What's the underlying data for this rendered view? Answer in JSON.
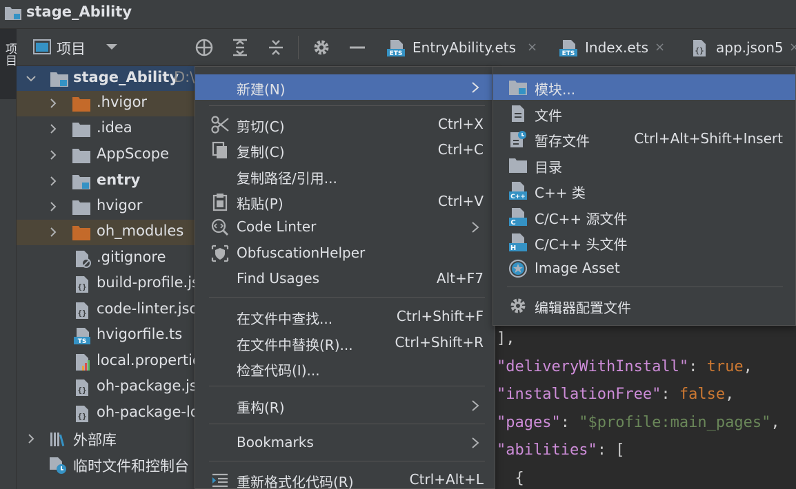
{
  "window": {
    "title": "stage_Ability"
  },
  "left_strip": {
    "tab_label": "项目"
  },
  "project_toolbar": {
    "label": "项目",
    "icons": [
      "project-window-icon",
      "dropdown-icon",
      "locate-icon",
      "expand-all-icon",
      "collapse-all-icon",
      "gear-icon",
      "hide-icon"
    ]
  },
  "editor_tabs": [
    {
      "label": "EntryAbility.ets",
      "icon": "ets-file-icon",
      "close": "×"
    },
    {
      "label": "Index.ets",
      "icon": "ets-file-icon",
      "close": "×"
    },
    {
      "label": "app.json5",
      "icon": "json-file-icon",
      "close": "×"
    }
  ],
  "tree": {
    "root": {
      "label": "stage_Ability",
      "path": "D:\\"
    },
    "items": [
      {
        "label": ".hvigor",
        "type": "folder-excluded"
      },
      {
        "label": ".idea",
        "type": "folder"
      },
      {
        "label": "AppScope",
        "type": "folder"
      },
      {
        "label": "entry",
        "type": "module"
      },
      {
        "label": "hvigor",
        "type": "folder"
      },
      {
        "label": "oh_modules",
        "type": "folder-excluded"
      },
      {
        "label": ".gitignore",
        "type": "file-ignore"
      },
      {
        "label": "build-profile.js",
        "type": "file-json"
      },
      {
        "label": "code-linter.jso",
        "type": "file-json"
      },
      {
        "label": "hvigorfile.ts",
        "type": "file-ts"
      },
      {
        "label": "local.propertie",
        "type": "file-props"
      },
      {
        "label": "oh-package.js",
        "type": "file-json"
      },
      {
        "label": "oh-package-lo",
        "type": "file-json"
      }
    ],
    "external_libraries": "外部库",
    "scratches": "临时文件和控制台"
  },
  "context_menu": {
    "items": [
      {
        "label": "新建(N)",
        "shortcut": "",
        "submenu": true,
        "highlighted": true
      },
      {
        "label": "剪切(C)",
        "shortcut": "Ctrl+X",
        "icon": "cut-icon"
      },
      {
        "label": "复制(C)",
        "shortcut": "Ctrl+C",
        "icon": "copy-icon"
      },
      {
        "label": "复制路径/引用...",
        "shortcut": ""
      },
      {
        "label": "粘贴(P)",
        "shortcut": "Ctrl+V",
        "icon": "paste-icon"
      },
      {
        "label": "Code Linter",
        "shortcut": "",
        "submenu": true,
        "icon": "code-linter-icon"
      },
      {
        "label": "ObfuscationHelper",
        "shortcut": "",
        "icon": "obfuscation-icon"
      },
      {
        "label": "Find Usages",
        "shortcut": "Alt+F7"
      },
      {
        "label": "在文件中查找...",
        "shortcut": "Ctrl+Shift+F"
      },
      {
        "label": "在文件中替换(R)...",
        "shortcut": "Ctrl+Shift+R"
      },
      {
        "label": "检查代码(I)...",
        "shortcut": ""
      },
      {
        "label": "重构(R)",
        "shortcut": "",
        "submenu": true
      },
      {
        "label": "Bookmarks",
        "shortcut": "",
        "submenu": true
      },
      {
        "label": "重新格式化代码(R)",
        "shortcut": "Ctrl+Alt+L",
        "icon": "reformat-icon"
      }
    ]
  },
  "submenu": {
    "items": [
      {
        "label": "模块...",
        "shortcut": "",
        "icon": "module-icon",
        "highlighted": true
      },
      {
        "label": "文件",
        "shortcut": "",
        "icon": "file-icon"
      },
      {
        "label": "暂存文件",
        "shortcut": "Ctrl+Alt+Shift+Insert",
        "icon": "scratch-file-icon"
      },
      {
        "label": "目录",
        "shortcut": "",
        "icon": "folder-icon"
      },
      {
        "label": "C++ 类",
        "shortcut": "",
        "icon": "cpp-class-icon"
      },
      {
        "label": "C/C++ 源文件",
        "shortcut": "",
        "icon": "c-source-icon"
      },
      {
        "label": "C/C++ 头文件",
        "shortcut": "",
        "icon": "c-header-icon"
      },
      {
        "label": "Image Asset",
        "shortcut": "",
        "icon": "image-asset-icon"
      },
      {
        "label": "编辑器配置文件",
        "shortcut": "",
        "icon": "editorconfig-icon"
      }
    ]
  },
  "editor": {
    "lines": [
      {
        "parts": [
          [
            "pun",
            "],"
          ]
        ]
      },
      {
        "parts": [
          [
            "str",
            "\"deliveryWithInstall\""
          ],
          [
            "pun",
            ": "
          ],
          [
            "kw",
            "true"
          ],
          [
            "pun",
            ","
          ]
        ]
      },
      {
        "parts": [
          [
            "str",
            "\"installationFree\""
          ],
          [
            "pun",
            ": "
          ],
          [
            "kw",
            "false"
          ],
          [
            "pun",
            ","
          ]
        ]
      },
      {
        "parts": [
          [
            "str",
            "\"pages\""
          ],
          [
            "pun",
            ": "
          ],
          [
            "val",
            "\"$profile:main_pages\""
          ],
          [
            "pun",
            ","
          ]
        ]
      },
      {
        "parts": [
          [
            "str",
            "\"abilities\""
          ],
          [
            "pun",
            ": ["
          ]
        ]
      },
      {
        "parts": [
          [
            "pun",
            "  {"
          ]
        ]
      }
    ]
  },
  "colors": {
    "menu_highlight": "#4b6eaf",
    "selection": "#2f4665",
    "excluded_folder": "#c46a2a",
    "module_badge": "#3592c4"
  }
}
